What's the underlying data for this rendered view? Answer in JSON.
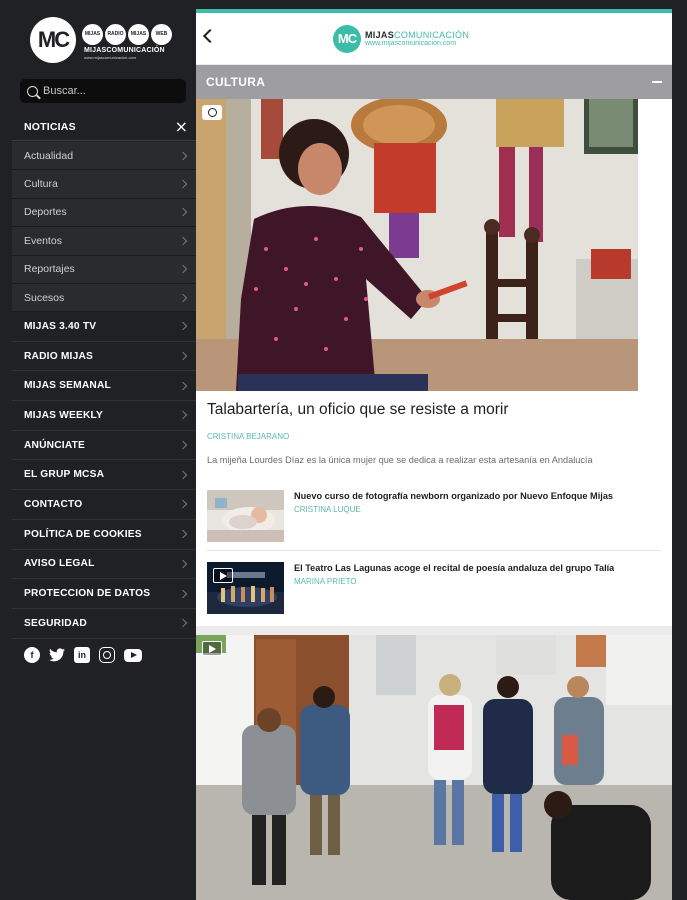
{
  "sidebar": {
    "logo": {
      "mark": "MC",
      "circles": [
        "MIJAS 3.40",
        "RADIO MIJAS",
        "MIJAS",
        "WEB"
      ],
      "brand": "MIJASCOMUNICACIÓN",
      "url": "www.mijascomunicacion.com"
    },
    "search": {
      "placeholder": "Buscar..."
    },
    "section": {
      "label": "NOTICIAS",
      "close_icon": "close-icon"
    },
    "sub_items": [
      "Actualidad",
      "Cultura",
      "Deportes",
      "Eventos",
      "Reportajes",
      "Sucesos"
    ],
    "main_items": [
      "MIJAS 3.40 TV",
      "RADIO MIJAS",
      "MIJAS SEMANAL",
      "MIJAS WEEKLY",
      "ANÚNCIATE",
      "EL GRUP MCSA",
      "CONTACTO",
      "POLÍTICA DE COOKIES",
      "AVISO LEGAL",
      "PROTECCION DE DATOS",
      "SEGURIDAD"
    ],
    "social": [
      "facebook-icon",
      "twitter-icon",
      "linkedin-icon",
      "instagram-icon",
      "youtube-icon"
    ]
  },
  "header": {
    "logo_mark": "MC",
    "brand_bold": "MIJAS",
    "brand_light": "COMUNICACIÓN",
    "url": "www.mijascomunicacion.com"
  },
  "section_bar": {
    "label": "CULTURA"
  },
  "hero": {
    "title": "Talabartería, un oficio que se resiste a morir",
    "author": "CRISTINA BEJARANO",
    "summary": "La mijeña Lourdes Díaz es la única mujer que se dedica a realizar esta artesanía en Andalucía"
  },
  "items": [
    {
      "title": "Nuevo curso de fotografía newborn organizado por Nuevo Enfoque Mijas",
      "author": "CRISTINA LUQUE"
    },
    {
      "title": "El Teatro Las Lagunas acoge el recital de poesía andaluza del grupo Talía",
      "author": "MARINA PRIETO"
    }
  ],
  "colors": {
    "accent": "#3dbda7",
    "sidebar_bg": "#202124",
    "section_bar": "#9e9ea0"
  }
}
